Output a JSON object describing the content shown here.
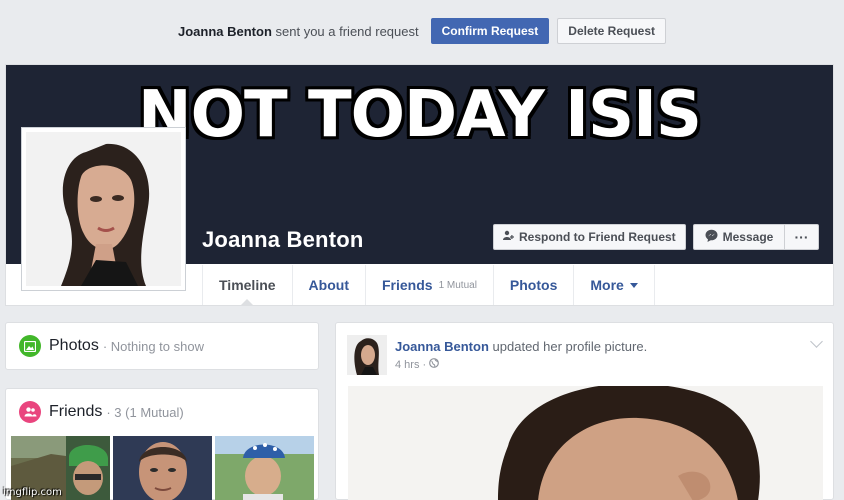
{
  "friend_request": {
    "name": "Joanna Benton",
    "text": "sent you a friend request",
    "confirm_label": "Confirm Request",
    "delete_label": "Delete Request"
  },
  "meme": {
    "caption": "NOT TODAY ISIS"
  },
  "profile": {
    "name": "Joanna Benton",
    "respond_label": "Respond to Friend Request",
    "message_label": "Message",
    "more_label": "···"
  },
  "tabs": [
    {
      "label": "Timeline"
    },
    {
      "label": "About"
    },
    {
      "label": "Friends",
      "sub": "1 Mutual"
    },
    {
      "label": "Photos"
    },
    {
      "label": "More"
    }
  ],
  "photos_box": {
    "title": "Photos",
    "subtitle": "· Nothing to show"
  },
  "friends_box": {
    "title": "Friends",
    "subtitle": "· 3 (1 Mutual)"
  },
  "post": {
    "author": "Joanna Benton",
    "action": "updated her profile picture.",
    "time": "4 hrs ·"
  },
  "watermark": "imgflip.com",
  "colors": {
    "accent": "#4267b2",
    "link": "#365899",
    "cover": "#1e2434"
  },
  "icons": [
    "friend-request-icon",
    "messenger-icon",
    "photos-icon",
    "friends-icon",
    "globe-icon",
    "chevron-down-icon"
  ]
}
